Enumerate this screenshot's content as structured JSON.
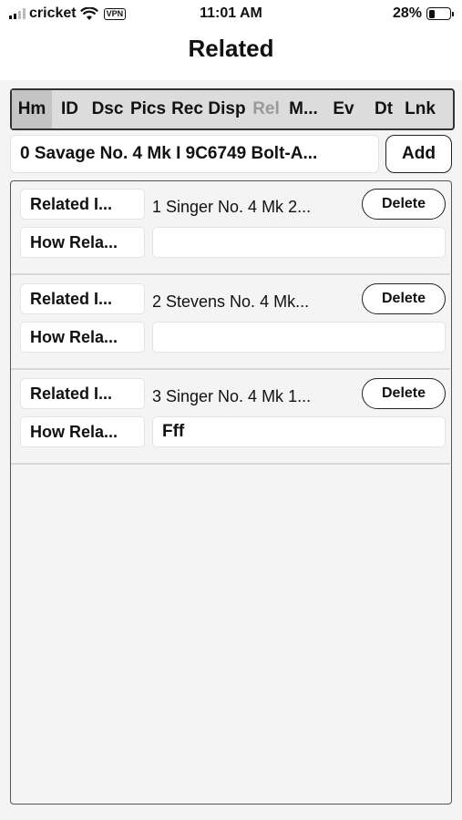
{
  "status_bar": {
    "carrier": "cricket",
    "vpn": "VPN",
    "time": "11:01 AM",
    "battery_percent": "28%",
    "battery_level": 0.28
  },
  "nav": {
    "title": "Related"
  },
  "tabs": [
    {
      "label": "Hm"
    },
    {
      "label": "ID"
    },
    {
      "label": "Dsc"
    },
    {
      "label": "Pics"
    },
    {
      "label": "Rec"
    },
    {
      "label": "Disp"
    },
    {
      "label": "Rel"
    },
    {
      "label": "M..."
    },
    {
      "label": "Ev"
    },
    {
      "label": "Dt"
    },
    {
      "label": "Lnk"
    }
  ],
  "current_item": {
    "value": "0 Savage  No. 4 Mk I 9C6749 Bolt-A...",
    "add_label": "Add"
  },
  "related": [
    {
      "label": "Related I...",
      "name": "1 Singer  No. 4 Mk 2...",
      "delete_label": "Delete",
      "how_label": "How Rela...",
      "how_value": ""
    },
    {
      "label": "Related I...",
      "name": "2 Stevens  No. 4 Mk...",
      "delete_label": "Delete",
      "how_label": "How Rela...",
      "how_value": ""
    },
    {
      "label": "Related I...",
      "name": "3 Singer  No. 4 Mk 1...",
      "delete_label": "Delete",
      "how_label": "How Rela...",
      "how_value": "Fff"
    }
  ]
}
